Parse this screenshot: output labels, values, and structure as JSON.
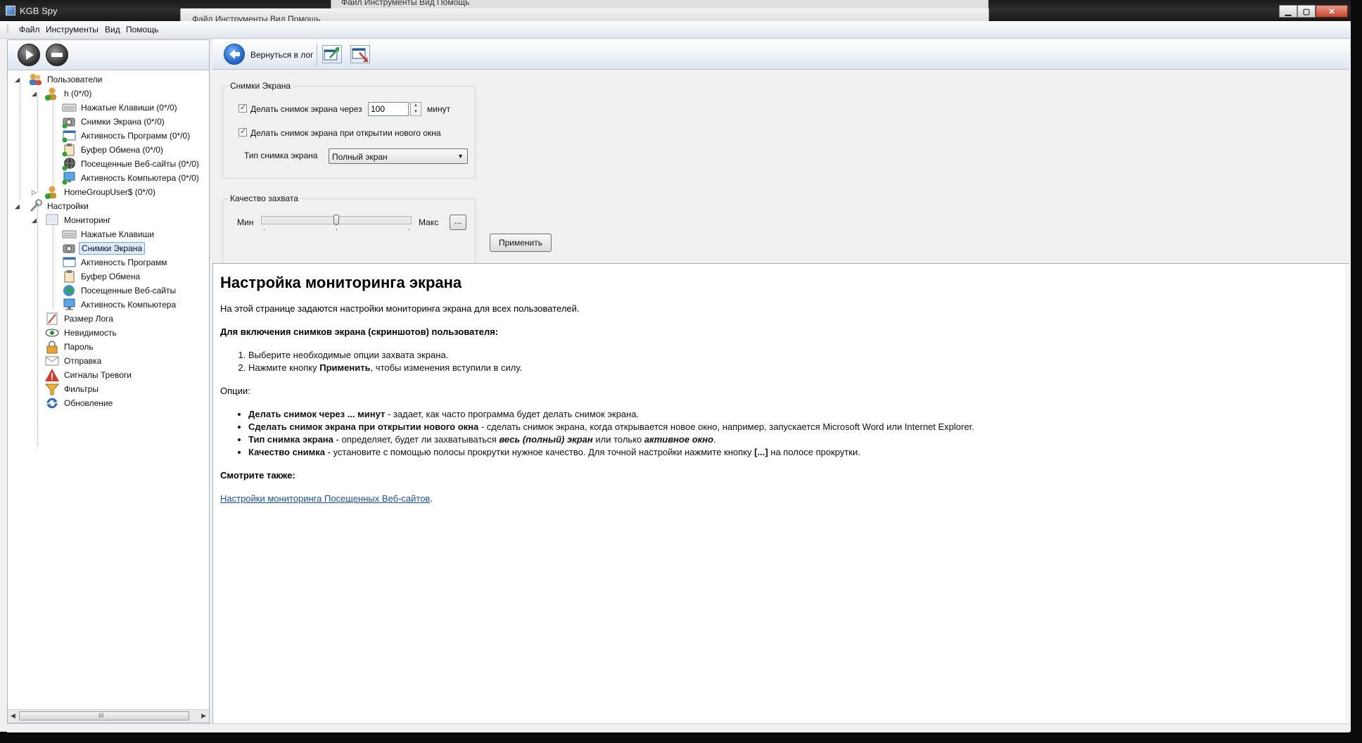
{
  "window": {
    "title": "KGB Spy",
    "controls": {
      "minimize": "▁",
      "maximize": "▢",
      "close": "✕"
    },
    "ghost_menu": "Файл  Инструменты  Вид  Помощь"
  },
  "menu": [
    "Файл",
    "Инструменты",
    "Вид",
    "Помощь"
  ],
  "tree": {
    "users": "Пользователи",
    "user_h": "h (0*/0)",
    "user_h_children": [
      "Нажатые Клавиши (0*/0)",
      "Снимки Экрана (0*/0)",
      "Активность Программ (0*/0)",
      "Буфер Обмена (0*/0)",
      "Посещенные Веб-сайты (0*/0)",
      "Активность Компьютера (0*/0)"
    ],
    "user_homegroup": "HomeGroupUser$ (0*/0)",
    "settings": "Настройки",
    "monitoring": "Мониторинг",
    "monitoring_children": [
      "Нажатые Клавиши",
      "Снимки Экрана",
      "Активность Программ",
      "Буфер Обмена",
      "Посещенные Веб-сайты",
      "Активность Компьютера"
    ],
    "settings_children": [
      "Размер Лога",
      "Невидимость",
      "Пароль",
      "Отправка",
      "Сигналы Тревоги",
      "Фильтры",
      "Обновление"
    ],
    "scroll_grip": "III"
  },
  "toolbar": {
    "back_label": "Вернуться в лог"
  },
  "screenshots": {
    "group_title": "Снимки Экрана",
    "interval_label": "Делать снимок экрана через",
    "interval_value": "100",
    "interval_unit": "минут",
    "on_new_window_label": "Делать снимок экрана при открытии нового окна",
    "type_label": "Тип снимка экрана",
    "type_value": "Полный экран"
  },
  "quality": {
    "group_title": "Качество захвата",
    "min_label": "Мин",
    "max_label": "Макс",
    "more_button": "...",
    "level": 0.5
  },
  "apply_button": "Применить",
  "help": {
    "title": "Настройка мониторинга экрана",
    "intro": "На этой странице задаются настройки мониторинга экрана для всех пользователей.",
    "enable_heading": "Для включения снимков экрана (скриншотов) пользователя:",
    "step1": "Выберите необходимые опции захвата экрана.",
    "step2_pre": "Нажмите кнопку ",
    "step2_bold": "Применить",
    "step2_post": ", чтобы изменения вступили в силу.",
    "options_heading": "Опции:",
    "opt1_bold": "Делать снимок через ... минут",
    "opt1_text": " - задает, как часто программа будет делать снимок экрана.",
    "opt2_bold": "Сделать снимок экрана при открытии нового окна",
    "opt2_text": " - сделать снимок экрана, когда открывается новое окно, например, запускается Microsoft Word или Internet Explorer.",
    "opt3_bold": "Тип снимка экрана",
    "opt3_text_a": " - определяет, будет ли захватываться ",
    "opt3_em1": "весь (полный) экран",
    "opt3_text_b": " или только ",
    "opt3_em2": "активное окно",
    "opt3_text_c": ".",
    "opt4_bold": "Качество снимка",
    "opt4_text_a": " - установите с помощью полосы прокрутки нужное качество. Для точной настройки нажмите кнопку ",
    "opt4_bold2": "[...]",
    "opt4_text_b": " на полосе прокрутки.",
    "see_also": "Смотрите также:",
    "link": "Настройки мониторинга Посещенных Веб-сайтов",
    "link_after": "."
  }
}
